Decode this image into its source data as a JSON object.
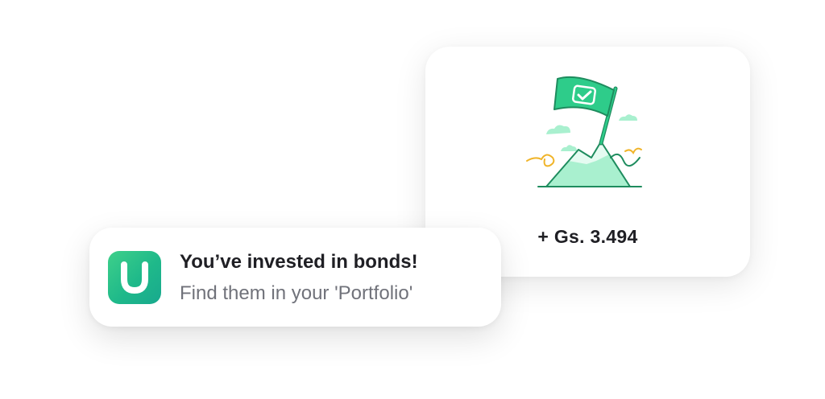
{
  "achievement_card": {
    "illustration_icon": "flag-on-mountain-icon",
    "amount": "+ Gs. 3.494"
  },
  "notification": {
    "app_icon": "u-logo-icon",
    "app_initial": "U",
    "title": "You’ve invested in bonds!",
    "body": "Find them in your 'Portfolio'"
  },
  "colors": {
    "brand_green": "#2ecc8a",
    "mint": "#a9f0cf",
    "accent_yellow": "#f0b429",
    "text_dark": "#1f1f24",
    "text_muted": "#70727a"
  }
}
